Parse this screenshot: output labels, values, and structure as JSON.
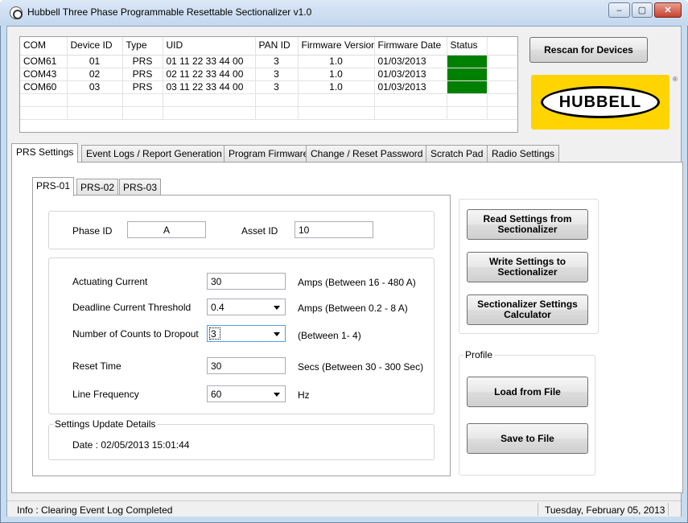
{
  "window": {
    "title": "Hubbell Three Phase Programmable Resettable Sectionalizer v1.0",
    "minimize": "‒",
    "maximize": "▢",
    "close": "✕"
  },
  "devices": {
    "headers": [
      "COM",
      "Device ID",
      "Type",
      "UID",
      "PAN ID",
      "Firmware Version",
      "Firmware Date",
      "Status"
    ],
    "rows": [
      {
        "com": "COM61",
        "device_id": "01",
        "type": "PRS",
        "uid": "01 11 22 33 44 00",
        "pan_id": "3",
        "fw_version": "1.0",
        "fw_date": "01/03/2013",
        "status_color": "#008000"
      },
      {
        "com": "COM43",
        "device_id": "02",
        "type": "PRS",
        "uid": "02 11 22 33 44 00",
        "pan_id": "3",
        "fw_version": "1.0",
        "fw_date": "01/03/2013",
        "status_color": "#008000"
      },
      {
        "com": "COM60",
        "device_id": "03",
        "type": "PRS",
        "uid": "03 11 22 33 44 00",
        "pan_id": "3",
        "fw_version": "1.0",
        "fw_date": "01/03/2013",
        "status_color": "#008000"
      }
    ]
  },
  "rescan_label": "Rescan for Devices",
  "logo": {
    "text": "HUBBELL",
    "reg": "®",
    "color": "#ffd400"
  },
  "tabs": [
    "PRS Settings",
    "Event Logs / Report Generation",
    "Program Firmware",
    "Change / Reset Password",
    "Scratch Pad",
    "Radio Settings"
  ],
  "subtabs": [
    "PRS-01",
    "PRS-02",
    "PRS-03"
  ],
  "ids": {
    "phase_label": "Phase ID",
    "phase_value": "A",
    "asset_label": "Asset ID",
    "asset_value": "10"
  },
  "settings": {
    "actuating_label": "Actuating Current",
    "actuating_value": "30",
    "actuating_hint": "Amps (Between 16 - 480 A)",
    "deadline_label": "Deadline Current Threshold",
    "deadline_value": "0.4",
    "deadline_hint": "Amps (Between 0.2 - 8 A)",
    "counts_label": "Number of Counts to Dropout",
    "counts_value": "3",
    "counts_hint": "(Between 1- 4)",
    "reset_label": "Reset Time",
    "reset_value": "30",
    "reset_hint": "Secs (Between 30 - 300 Sec)",
    "freq_label": "Line Frequency",
    "freq_value": "60",
    "freq_hint": "Hz"
  },
  "update": {
    "title": "Settings Update Details",
    "date": "Date : 02/05/2013 15:01:44"
  },
  "actions": {
    "read": "Read Settings from Sectionalizer",
    "write": "Write Settings to Sectionalizer",
    "calculator": "Sectionalizer Settings Calculator"
  },
  "profile": {
    "title": "Profile",
    "load": "Load from File",
    "save": "Save to File"
  },
  "statusbar": {
    "info": "Info : Clearing Event Log Completed",
    "date": "Tuesday, February 05, 2013"
  }
}
